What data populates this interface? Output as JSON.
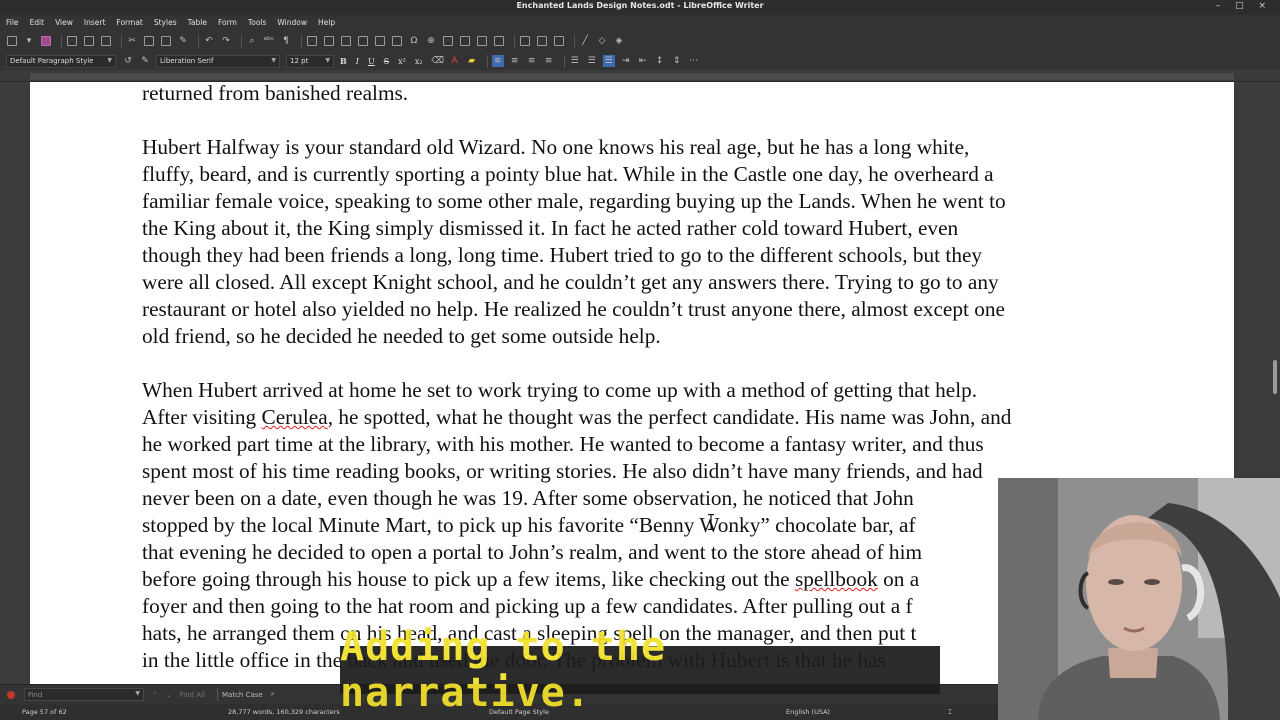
{
  "window": {
    "title": "Enchanted Lands Design Notes.odt - LibreOffice Writer",
    "controls": [
      "–",
      "□",
      "×"
    ]
  },
  "menu": [
    "File",
    "Edit",
    "View",
    "Insert",
    "Format",
    "Styles",
    "Table",
    "Form",
    "Tools",
    "Window",
    "Help"
  ],
  "formatting": {
    "paragraph_style": "Default Paragraph Style",
    "font_name": "Liberation Serif",
    "font_size": "12 pt",
    "bold": "B",
    "italic": "I",
    "underline": "U",
    "strike": "S",
    "superscript": "x²",
    "subscript": "x₂"
  },
  "document": {
    "paragraph1": [
      "returned from banished realms."
    ],
    "paragraph2": [
      "Hubert Halfway is your standard old Wizard.  No one knows his real age, but he has a long white,",
      "fluffy, beard, and is currently sporting a pointy blue hat.  While in the Castle one day, he overheard a",
      "familiar female voice, speaking to some other male, regarding buying up the Lands.  When he went to",
      "the King about it, the King simply dismissed it.  In fact he acted rather cold toward Hubert, even",
      "though they had been friends a long, long time.  Hubert tried to go to the different schools, but they",
      "were all closed.  All except Knight school, and he couldn’t get any answers there.  Trying to go to any",
      "restaurant or hotel also yielded no help.  He realized he couldn’t trust anyone there, almost except one",
      "old friend, so he decided he needed to get some outside help."
    ],
    "paragraph3": {
      "line1": "When Hubert arrived at home he set to work trying to come up with a method of getting that help.",
      "line2_before": "After visiting ",
      "line2_spell": "Cerulea",
      "line2_after": ", he spotted, what he thought was the perfect candidate.  His name was John, and",
      "line3": "he worked part time at the library, with his mother.  He wanted to become a fantasy writer, and thus",
      "line4": "spent most of his time reading books, or writing stories.  He also didn’t have many friends, and had",
      "line5": "never been on a date, even though he was 19.  After some observation, he noticed that John",
      "line6": "stopped by the local Minute Mart, to pick up his favorite “Benny Wonky” chocolate bar, af",
      "line7": "that evening he decided to open a portal to John’s realm, and went to the store ahead of him",
      "line8_before": "before going through his house to pick up a few items, like checking out the ",
      "line8_spell": "spellbook",
      "line8_after": " on a",
      "line9": "foyer and then going to the hat room and picking up a few candidates.  After pulling out a f",
      "line10": "hats, he arranged them on his head, and cast a sleeping spell on the manager, and then put t",
      "line11": "in the little office in the back and used the door.  The problem with Hubert is that he has"
    }
  },
  "findbar": {
    "placeholder": "Find",
    "find_all": "Find All",
    "match_case": "Match Case"
  },
  "status": {
    "page": "Page 57 of 62",
    "words": "28,777 words, 160,329 characters",
    "page_style": "Default Page Style",
    "language": "English (USA)"
  },
  "caption": "Adding to the narrative.",
  "colors": {
    "caption_text": "#f2e12b",
    "caption_bg": "#1c1c1c",
    "spell_underline": "#dd2222",
    "align_active": "#3d6ab0"
  }
}
